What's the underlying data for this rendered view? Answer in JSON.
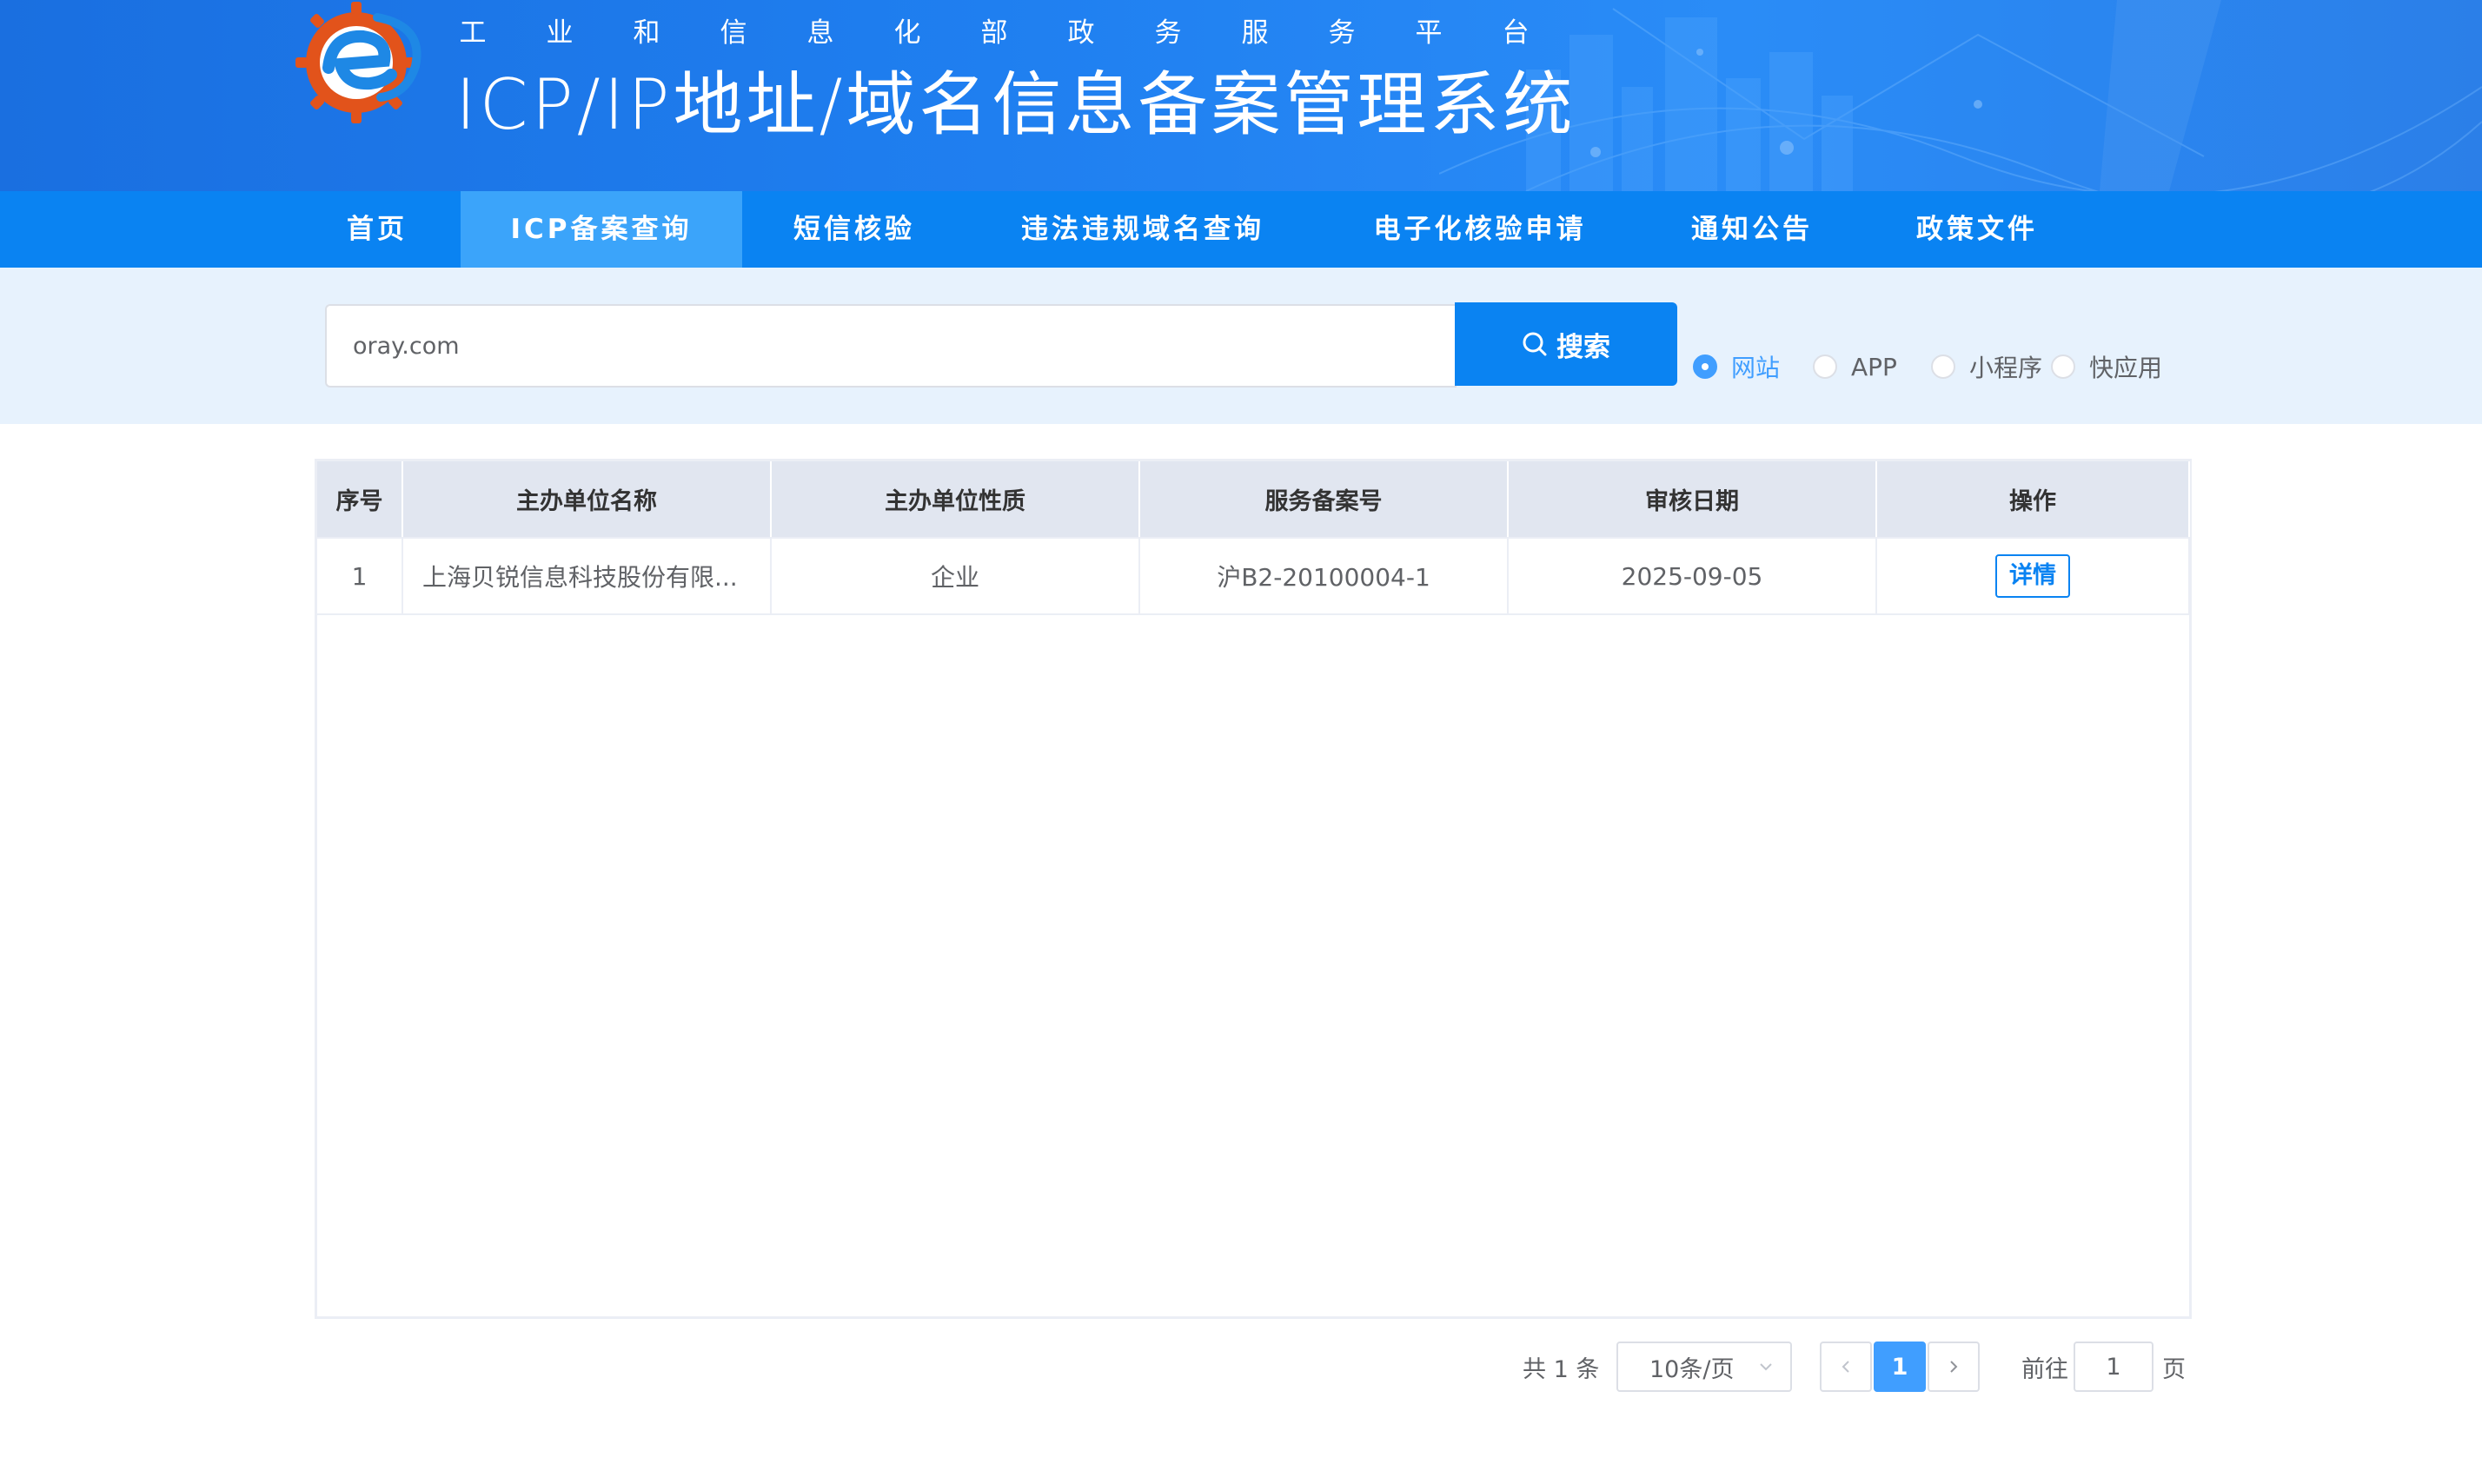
{
  "header": {
    "subtitle_chars": [
      "工",
      "业",
      "和",
      "信",
      "息",
      "化",
      "部",
      "政",
      "务",
      "服",
      "务",
      "平",
      "台"
    ],
    "title": "ICP/IP地址/域名信息备案管理系统"
  },
  "nav": {
    "items": [
      {
        "label": "首页"
      },
      {
        "label": "ICP备案查询"
      },
      {
        "label": "短信核验"
      },
      {
        "label": "违法违规域名查询"
      },
      {
        "label": "电子化核验申请"
      },
      {
        "label": "通知公告"
      },
      {
        "label": "政策文件"
      }
    ],
    "active": "ICP备案查询"
  },
  "search": {
    "value": "oray.com",
    "button_label": "搜索",
    "types": [
      {
        "label": "网站",
        "checked": true
      },
      {
        "label": "APP",
        "checked": false
      },
      {
        "label": "小程序",
        "checked": false
      },
      {
        "label": "快应用",
        "checked": false
      }
    ]
  },
  "table": {
    "columns": [
      "序号",
      "主办单位名称",
      "主办单位性质",
      "服务备案号",
      "审核日期",
      "操作"
    ],
    "rows": [
      {
        "index": "1",
        "org_name": "上海贝锐信息科技股份有限...",
        "org_type": "企业",
        "license": "沪B2-20100004-1",
        "date": "2025-09-05",
        "action": "详情"
      }
    ]
  },
  "pagination": {
    "total_text": "共 1 条",
    "page_size": "10条/页",
    "current_page": "1",
    "goto_prefix": "前往",
    "goto_value": "1",
    "goto_suffix": "页"
  },
  "colors": {
    "header_blue": "#1f7ff0",
    "nav_blue": "#0a83f2",
    "nav_active": "#3ba4fa",
    "search_band": "#e7f2fd",
    "accent": "#409eff"
  }
}
